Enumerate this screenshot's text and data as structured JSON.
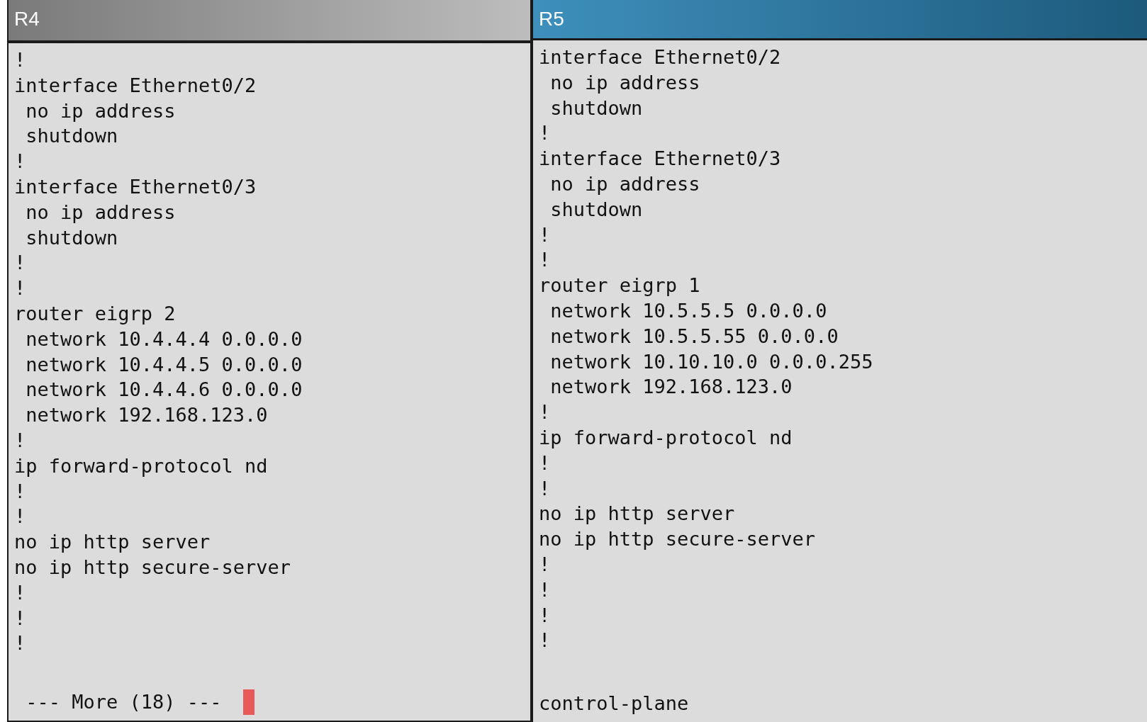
{
  "panes": [
    {
      "title": "R4",
      "lines": [
        "!",
        "interface Ethernet0/2",
        " no ip address",
        " shutdown",
        "!",
        "interface Ethernet0/3",
        " no ip address",
        " shutdown",
        "!",
        "!",
        "router eigrp 2",
        " network 10.4.4.4 0.0.0.0",
        " network 10.4.4.5 0.0.0.0",
        " network 10.4.4.6 0.0.0.0",
        " network 192.168.123.0",
        "!",
        "ip forward-protocol nd",
        "!",
        "!",
        "no ip http server",
        "no ip http secure-server",
        "!",
        "!",
        "!"
      ],
      "tail": {
        "kind": "more",
        "text": " --- More (18) --- "
      }
    },
    {
      "title": "R5",
      "lines": [
        "interface Ethernet0/2",
        " no ip address",
        " shutdown",
        "!",
        "interface Ethernet0/3",
        " no ip address",
        " shutdown",
        "!",
        "!",
        "router eigrp 1",
        " network 10.5.5.5 0.0.0.0",
        " network 10.5.5.55 0.0.0.0",
        " network 10.10.10.0 0.0.0.255",
        " network 192.168.123.0",
        "!",
        "ip forward-protocol nd",
        "!",
        "!",
        "no ip http server",
        "no ip http secure-server",
        "!",
        "!",
        "!",
        "!"
      ],
      "tail": {
        "kind": "line",
        "text": "control-plane"
      }
    }
  ]
}
